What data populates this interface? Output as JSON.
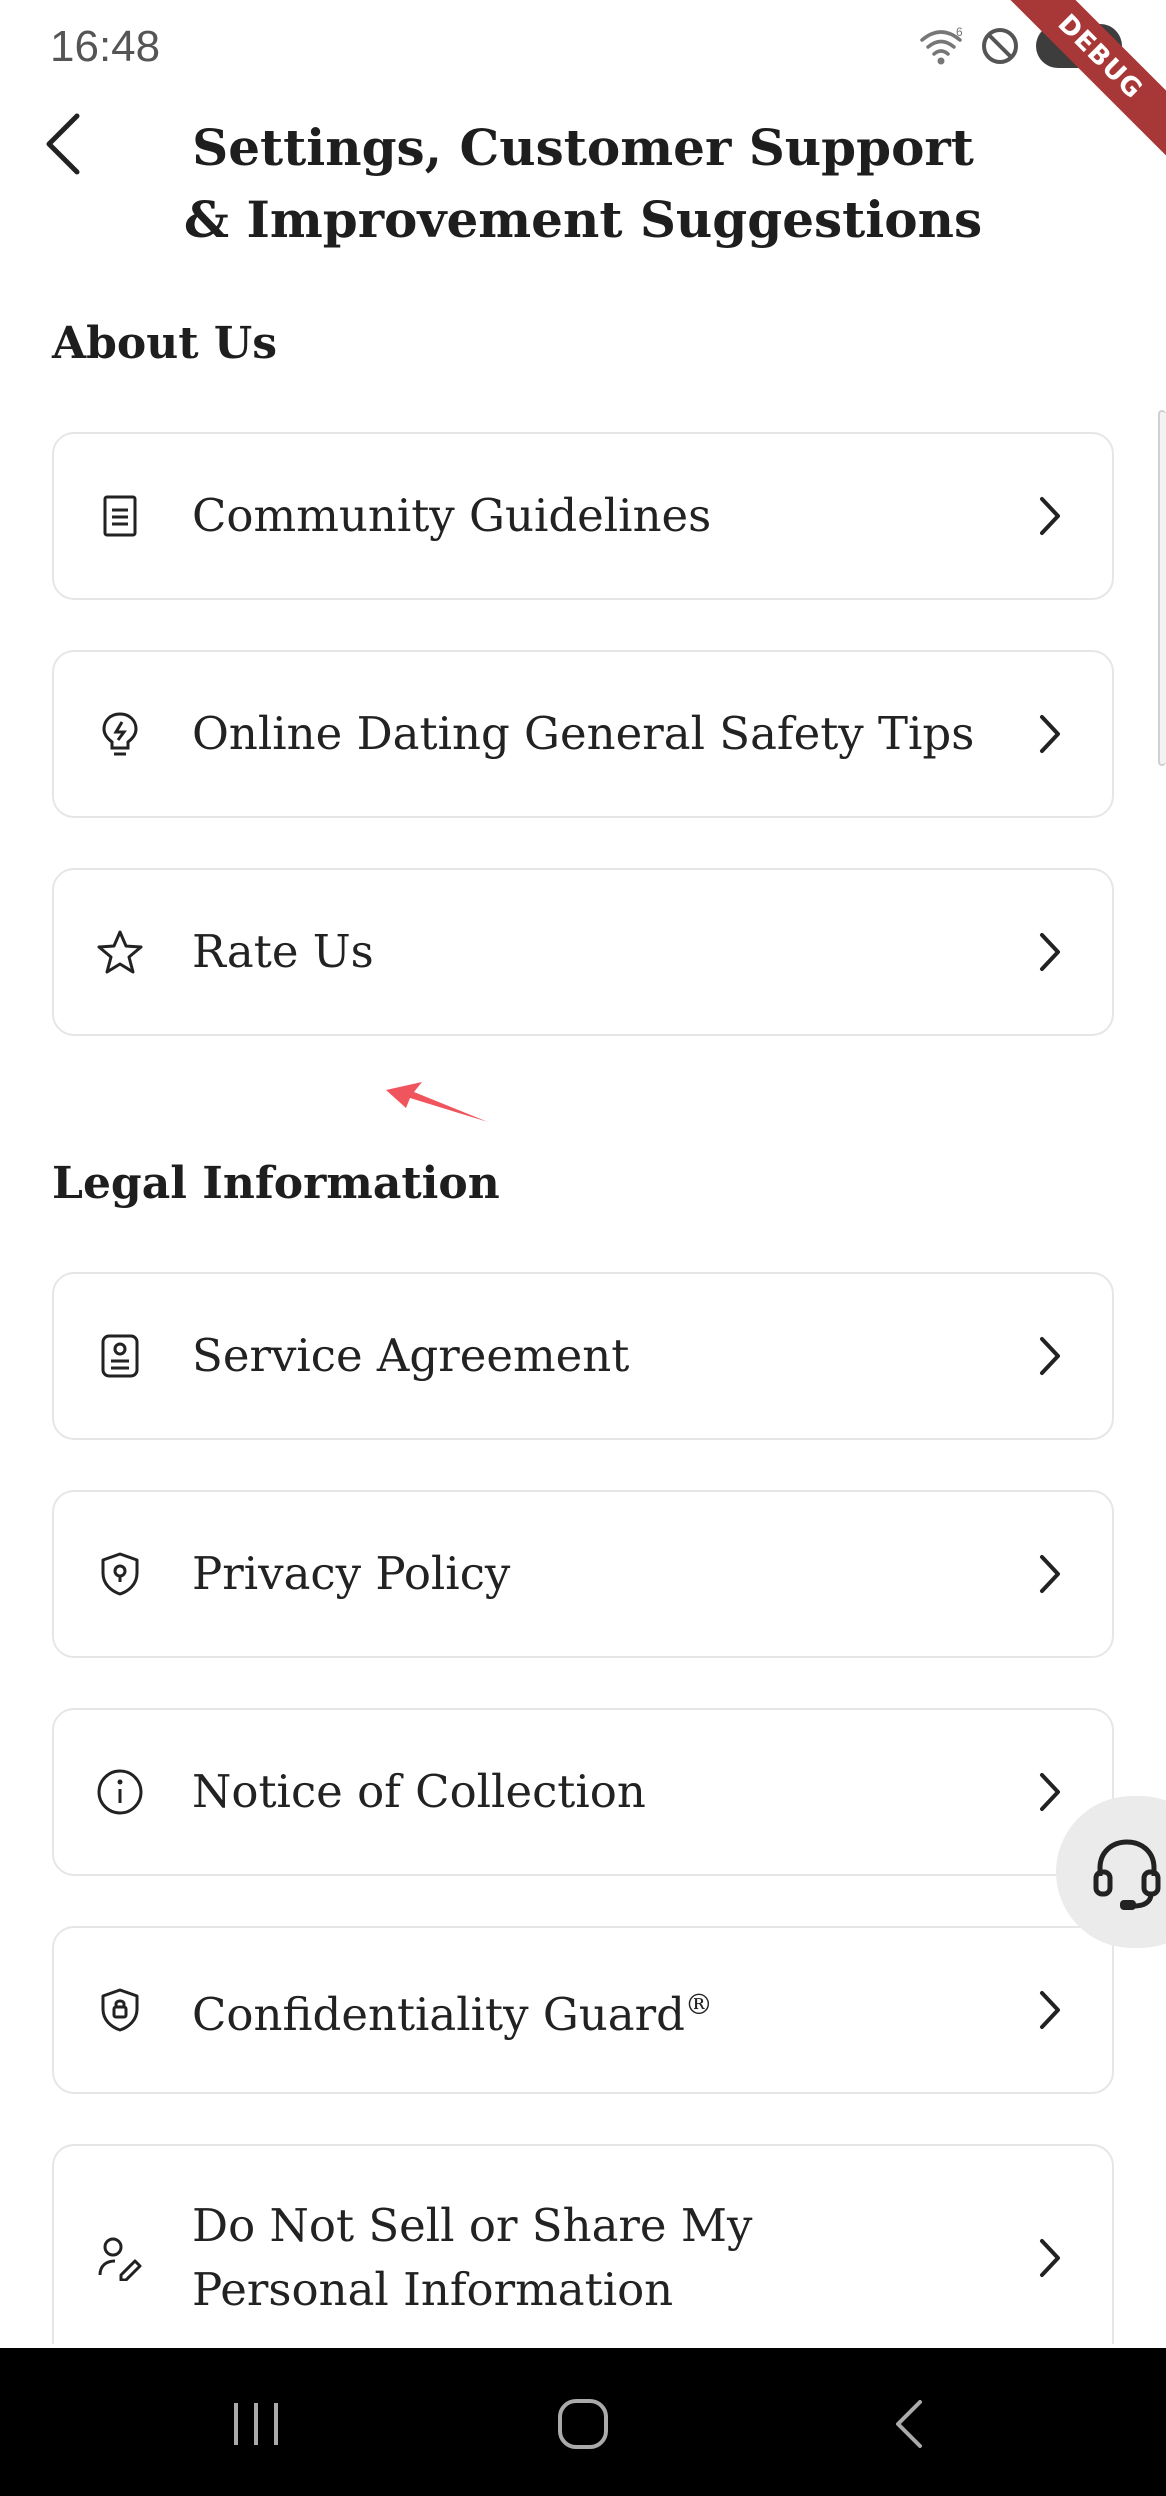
{
  "status_bar": {
    "time": "16:48",
    "battery": "98",
    "icons": [
      "wifi-icon",
      "do-not-disturb-icon",
      "battery-icon"
    ]
  },
  "debug_banner": "DEBUG",
  "header": {
    "back_icon": "chevron-left-icon",
    "title": "Settings, Customer Support & Improvement Suggestions"
  },
  "sections": {
    "about": {
      "heading": "About Us",
      "items": [
        {
          "label": "Community Guidelines",
          "icon": "document-icon"
        },
        {
          "label": "Online Dating General Safety Tips",
          "icon": "lightbulb-icon"
        },
        {
          "label": "Rate Us",
          "icon": "star-icon"
        }
      ]
    },
    "legal": {
      "heading": "Legal Information",
      "items": [
        {
          "label": "Service Agreement",
          "icon": "agreement-icon"
        },
        {
          "label": "Privacy Policy",
          "icon": "shield-icon"
        },
        {
          "label": "Notice of Collection",
          "icon": "info-icon"
        },
        {
          "label": "Confidentiality Guard",
          "suffix": "®",
          "icon": "shield-lock-icon"
        },
        {
          "label": "Do Not Sell or Share My Personal Information",
          "icon": "person-edit-icon"
        }
      ]
    }
  },
  "support_button": {
    "icon": "headset-icon"
  },
  "nav_bar": {
    "buttons": [
      "recents-icon",
      "home-icon",
      "back-icon"
    ]
  },
  "colors": {
    "background": "#ffffff",
    "card_border": "#e6e6e6",
    "text": "#1f1f1f",
    "debug_banner": "#a83838",
    "pointer_arrow": "#f0545c",
    "nav_bar": "#000000"
  }
}
